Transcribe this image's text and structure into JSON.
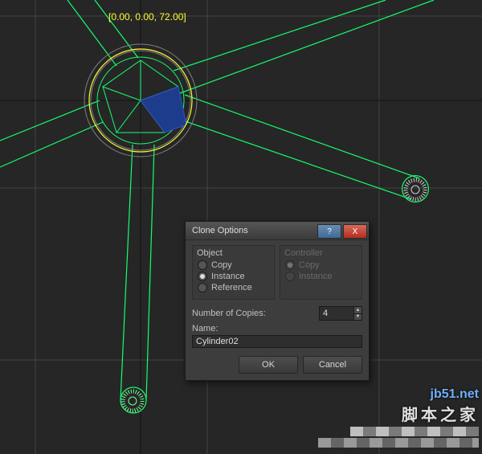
{
  "viewport": {
    "coord_readout": "[0.00, 0.00, 72.00]"
  },
  "dialog": {
    "title": "Clone Options",
    "object_group": {
      "title": "Object",
      "copy": "Copy",
      "instance": "Instance",
      "reference": "Reference"
    },
    "controller_group": {
      "title": "Controller",
      "copy": "Copy",
      "instance": "Instance"
    },
    "num_copies_label": "Number of Copies:",
    "num_copies_value": "4",
    "name_label": "Name:",
    "name_value": "Cylinder02",
    "ok": "OK",
    "cancel": "Cancel",
    "help": "?",
    "close": "X"
  },
  "watermark": {
    "url": "jb51.net",
    "text": "脚本之家"
  }
}
